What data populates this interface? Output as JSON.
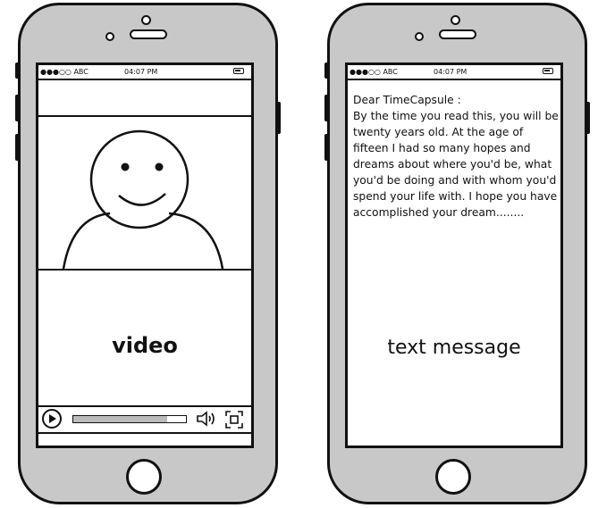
{
  "status_bar": {
    "carrier": "●●●○○ ABC",
    "time": "04:07 PM"
  },
  "left_phone": {
    "label": "video",
    "progress": 0.83
  },
  "right_phone": {
    "greeting": "Dear TimeCapsule :",
    "body": "By the time you read this, you will be twenty years old. At the age of fifteen I had so many hopes and dreams about where you'd be, what you'd be doing and with whom you'd spend your life with. I hope you have accomplished your dream........",
    "label": "text message"
  },
  "icons": [
    "play-icon",
    "volume-icon",
    "fullscreen-icon",
    "battery-icon"
  ]
}
